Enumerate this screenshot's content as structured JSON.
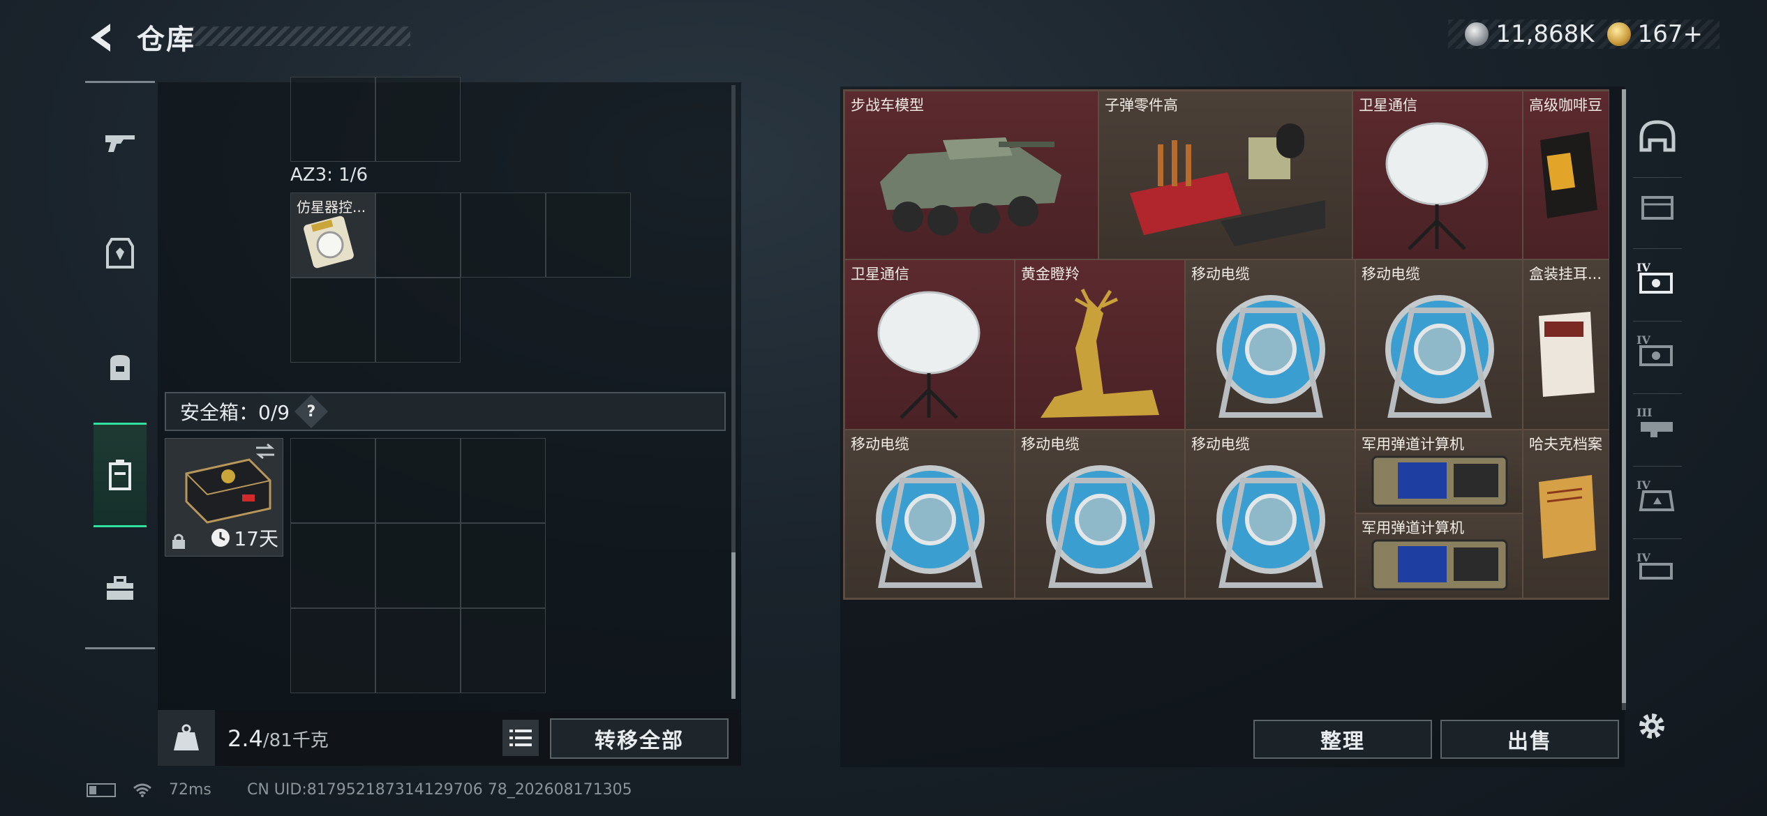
{
  "header": {
    "title": "仓库",
    "currency_silver": "11,868K",
    "currency_gold": "167+"
  },
  "categories": [
    {
      "icon": "rifle-icon"
    },
    {
      "icon": "armor-icon"
    },
    {
      "icon": "backpack-icon"
    },
    {
      "icon": "container-icon",
      "active": true
    },
    {
      "icon": "toolbox-icon"
    }
  ],
  "left": {
    "az3_label": "AZ3: 1/6",
    "az3_item_label": "仿星器控...",
    "safebox_label": "安全箱：0/9",
    "safebox_help": "?",
    "safe_item_days": "17天",
    "weight_current": "2.4",
    "weight_max": "/81千克",
    "kg_label": "KG",
    "transfer_all": "转移全部"
  },
  "stash": {
    "items": [
      {
        "label": "步战车模型",
        "color": "red"
      },
      {
        "label": "子弹零件高",
        "color": "brown"
      },
      {
        "label": "卫星通信",
        "color": "red"
      },
      {
        "label": "高级咖啡豆",
        "color": "red"
      },
      {
        "label": "卫星通信",
        "color": "red"
      },
      {
        "label": "黄金瞪羚",
        "color": "red"
      },
      {
        "label": "移动电缆",
        "color": "brown"
      },
      {
        "label": "移动电缆",
        "color": "brown"
      },
      {
        "label": "盒装挂耳...",
        "color": "brown"
      },
      {
        "label": "移动电缆",
        "color": "brown"
      },
      {
        "label": "移动电缆",
        "color": "brown"
      },
      {
        "label": "移动电缆",
        "color": "brown"
      },
      {
        "label": "军用弹道计算机",
        "color": "brown"
      },
      {
        "label": "军用弹道计算机",
        "color": "brown"
      },
      {
        "label": "哈夫克档案",
        "color": "brown"
      }
    ],
    "sort_label": "整理",
    "sell_label": "出售"
  },
  "filters": [
    "helmet-icon",
    "crate-icon",
    "tier-IV-icon",
    "tier-IV-icon",
    "tier-III-icon",
    "tier-IV-icon",
    "tier-IV-icon"
  ],
  "status": {
    "ping": "72ms",
    "uid": "CN UID:817952187314129706 78_202608171305"
  },
  "colors": {
    "accent_green": "#2fe2a0",
    "tile_red": "#5b2a2e",
    "tile_brown": "#4b4038"
  }
}
